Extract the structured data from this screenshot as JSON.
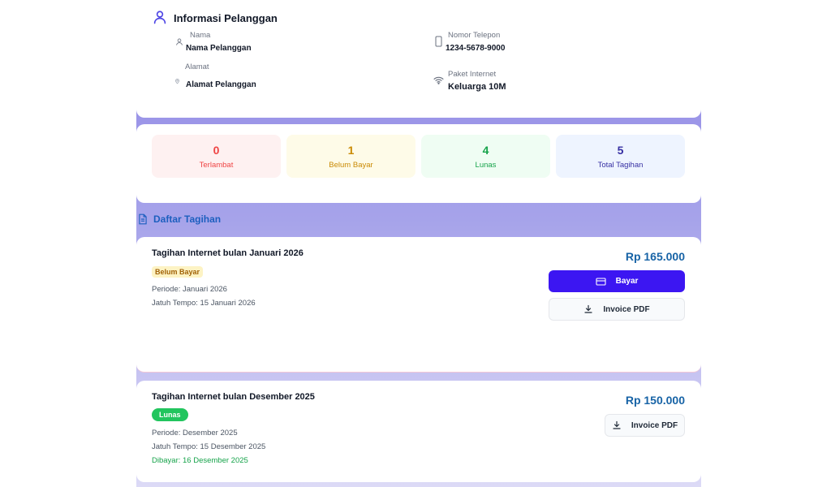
{
  "customer": {
    "title": "Informasi Pelanggan",
    "name_label": "Nama",
    "name_value": "Nama Pelanggan",
    "address_label": "Alamat",
    "address_value": "Alamat  Pelanggan",
    "phone_label": "Nomor Telepon",
    "phone_value": "1234-5678-9000",
    "package_label": "Paket Internet",
    "package_value": "Keluarga 10M"
  },
  "stats": [
    {
      "value": "0",
      "label": "Terlambat",
      "color": "#ef4444",
      "bg": "#fef1f1"
    },
    {
      "value": "1",
      "label": "Belum Bayar",
      "color": "#ca8a04",
      "bg": "#fefbe8"
    },
    {
      "value": "4",
      "label": "Lunas",
      "color": "#16a34a",
      "bg": "#effdf3"
    },
    {
      "value": "5",
      "label": "Total Tagihan",
      "color": "#3730a3",
      "bg": "#eef4ff"
    }
  ],
  "bills_section": {
    "title": "Daftar Tagihan"
  },
  "bills": [
    {
      "title": "Tagihan Internet bulan Januari 2026",
      "status": "Belum Bayar",
      "period": "Periode: Januari 2026",
      "due": "Jatuh Tempo: 15 Januari 2026",
      "amount": "Rp 165.000",
      "pay_label": "Bayar",
      "pdf_label": "Invoice PDF"
    },
    {
      "title": "Tagihan Internet bulan Desember 2025",
      "status": "Lunas",
      "period": "Periode: Desember 2025",
      "due": "Jatuh Tempo: 15 Desember 2025",
      "paid": "Dibayar: 16 Desember 2025",
      "amount": "Rp 150.000",
      "pdf_label": "Invoice PDF"
    }
  ],
  "icons": {
    "customer": "user-icon",
    "name": "user-icon",
    "address": "location-icon",
    "phone": "phone-icon",
    "package": "wifi-icon",
    "section": "document-icon",
    "pay": "credit-card-icon",
    "pdf": "download-icon"
  },
  "colors": {
    "accent": "#3c16f2",
    "amount": "#1763a6",
    "section_title": "#1d5fbf",
    "background": "#9c97e8"
  }
}
